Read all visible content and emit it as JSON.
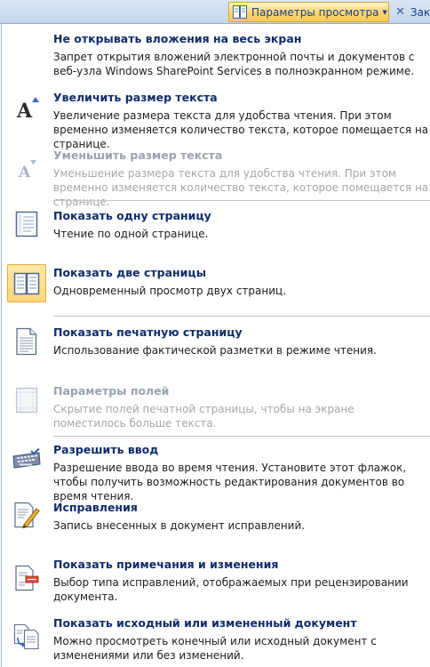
{
  "toolbar": {
    "view_options_label": "Параметры просмотра",
    "close_label": "Зак"
  },
  "menu": {
    "items": [
      {
        "title": "Не открывать вложения на весь экран",
        "desc": "Запрет открытия вложений электронной почты и документов с веб-узла Windows SharePoint Services в полноэкранном режиме.",
        "icon": "none",
        "enabled": true
      },
      {
        "title": "Увеличить размер текста",
        "desc": "Увеличение размера текста для удобства чтения. При этом временно изменяется количество текста, которое помещается на странице.",
        "icon": "increase-text-icon",
        "enabled": true
      },
      {
        "title": "Уменьшить размер текста",
        "desc": "Уменьшение размера текста для удобства чтения. При этом временно изменяется количество текста, которое помещается на странице.",
        "icon": "decrease-text-icon",
        "enabled": false
      },
      {
        "title": "Показать одну страницу",
        "desc": "Чтение по одной странице.",
        "icon": "one-page-icon",
        "enabled": true
      },
      {
        "title": "Показать две страницы",
        "desc": "Одновременный просмотр двух страниц.",
        "icon": "two-pages-icon",
        "enabled": true,
        "selected": true
      },
      {
        "title": "Показать печатную страницу",
        "desc": "Использование фактической разметки в режиме чтения.",
        "icon": "print-page-icon",
        "enabled": true
      },
      {
        "title": "Параметры полей",
        "desc": "Скрытие полей печатной страницы, чтобы на экране поместилось больше текста.",
        "icon": "margins-icon",
        "enabled": false
      },
      {
        "title": "Разрешить ввод",
        "desc": "Разрешение ввода во время чтения. Установите этот флажок, чтобы получить возможность редактирования документов во время чтения.",
        "icon": "keyboard-icon",
        "enabled": true
      },
      {
        "title": "Исправления",
        "desc": "Запись внесенных в документ исправлений.",
        "icon": "track-changes-icon",
        "enabled": true
      },
      {
        "title": "Показать примечания и изменения",
        "desc": "Выбор типа исправлений, отображаемых при рецензировании документа.",
        "icon": "show-markup-icon",
        "enabled": true
      },
      {
        "title": "Показать исходный или измененный документ",
        "desc": "Можно просмотреть конечный или исходный документ с изменениями или без изменений.",
        "icon": "original-final-icon",
        "enabled": true
      }
    ]
  }
}
